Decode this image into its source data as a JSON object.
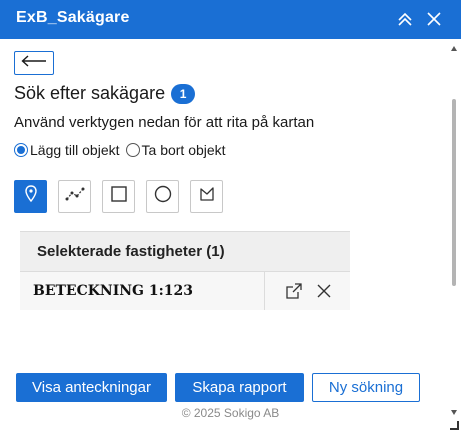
{
  "header": {
    "title": "ExB_Sakägare",
    "collapse_icon": "double-chevron-up-icon",
    "close_icon": "close-icon"
  },
  "back_button": {
    "icon": "arrow-left-icon"
  },
  "main": {
    "title": "Sök efter sakägare",
    "badge": "1",
    "instruction": "Använd verktygen nedan för att rita på kartan",
    "radio_options": [
      {
        "label": "Lägg till objekt",
        "checked": true
      },
      {
        "label": "Ta bort objekt",
        "checked": false
      }
    ],
    "tools": [
      {
        "name": "point",
        "icon": "map-pin-icon",
        "active": true
      },
      {
        "name": "polyline",
        "icon": "polyline-icon",
        "active": false
      },
      {
        "name": "rectangle",
        "icon": "rectangle-icon",
        "active": false
      },
      {
        "name": "circle",
        "icon": "circle-icon",
        "active": false
      },
      {
        "name": "freehand",
        "icon": "freehand-polygon-icon",
        "active": false
      }
    ]
  },
  "results": {
    "header": "Selekterade fastigheter (1)",
    "rows": [
      {
        "label": "BETECKNING 1:123",
        "open_icon": "open-external-icon",
        "remove_icon": "close-icon"
      }
    ]
  },
  "footer": {
    "buttons": [
      {
        "label": "Visa anteckningar",
        "style": "primary"
      },
      {
        "label": "Skapa rapport",
        "style": "primary"
      },
      {
        "label": "Ny sökning",
        "style": "outline"
      }
    ],
    "copyright": "© 2025 Sokigo AB"
  },
  "colors": {
    "accent": "#1a6fd4",
    "header_bg": "#1a6fd4",
    "table_header_bg": "#efefef"
  }
}
